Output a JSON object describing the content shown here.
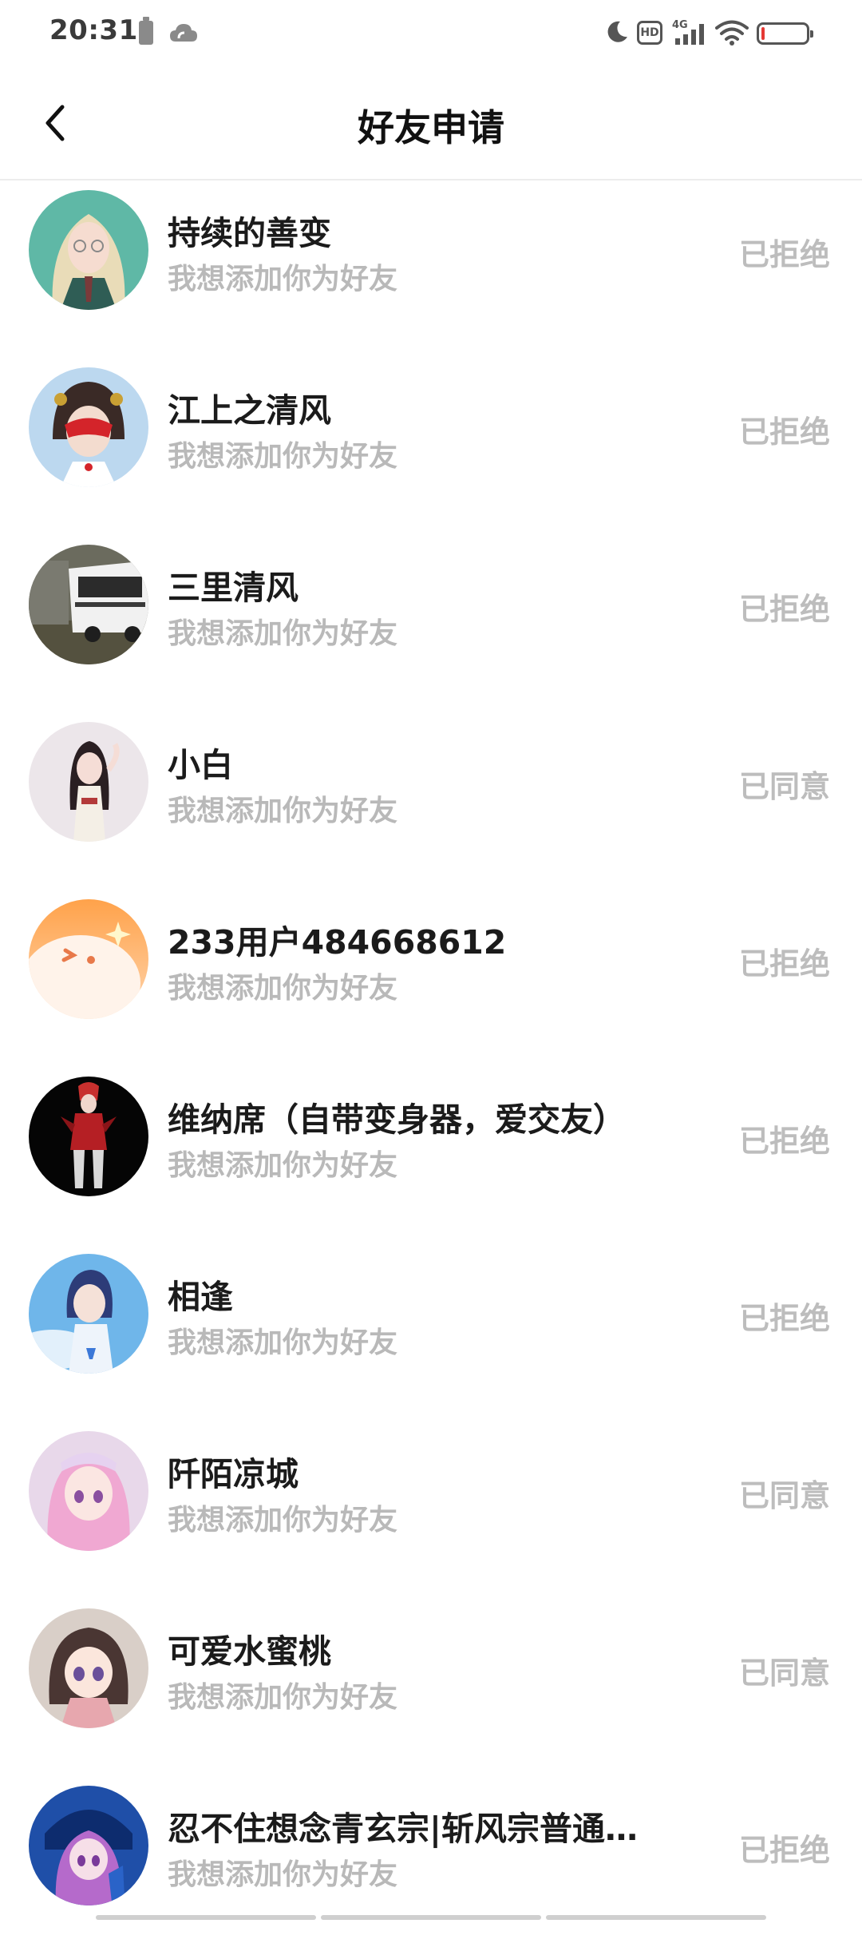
{
  "status_bar": {
    "time": "20:31",
    "hd_label": "HD",
    "network_label": "4G",
    "icons": [
      "battery-saver-icon",
      "cloud-icon",
      "moon-icon",
      "hd-icon",
      "signal-4g-icon",
      "wifi-icon",
      "battery-icon"
    ],
    "battery_level": 0.08
  },
  "header": {
    "back_icon": "chevron-left-icon",
    "title": "好友申请"
  },
  "requests": [
    {
      "name": "持续的善变",
      "message": "我想添加你为好友",
      "status": "已拒绝"
    },
    {
      "name": "江上之清风",
      "message": "我想添加你为好友",
      "status": "已拒绝"
    },
    {
      "name": "三里清风",
      "message": "我想添加你为好友",
      "status": "已拒绝"
    },
    {
      "name": "小白",
      "message": "我想添加你为好友",
      "status": "已同意"
    },
    {
      "name": "233用户484668612",
      "message": "我想添加你为好友",
      "status": "已拒绝"
    },
    {
      "name": "维纳席（自带变身器，爱交友）",
      "message": "我想添加你为好友",
      "status": "已拒绝"
    },
    {
      "name": "相逢",
      "message": "我想添加你为好友",
      "status": "已拒绝"
    },
    {
      "name": "阡陌凉城",
      "message": "我想添加你为好友",
      "status": "已同意"
    },
    {
      "name": "可爱水蜜桃",
      "message": "我想添加你为好友",
      "status": "已同意"
    },
    {
      "name": "忍不住想念青玄宗|斩风宗普通…",
      "message": "我想添加你为好友",
      "status": "已拒绝"
    }
  ],
  "colors": {
    "name_text": "#1b1b1b",
    "message_text": "#b9b9b9",
    "status_text": "#bdbdbd",
    "divider": "#ececec",
    "battery_low": "#e53935"
  }
}
